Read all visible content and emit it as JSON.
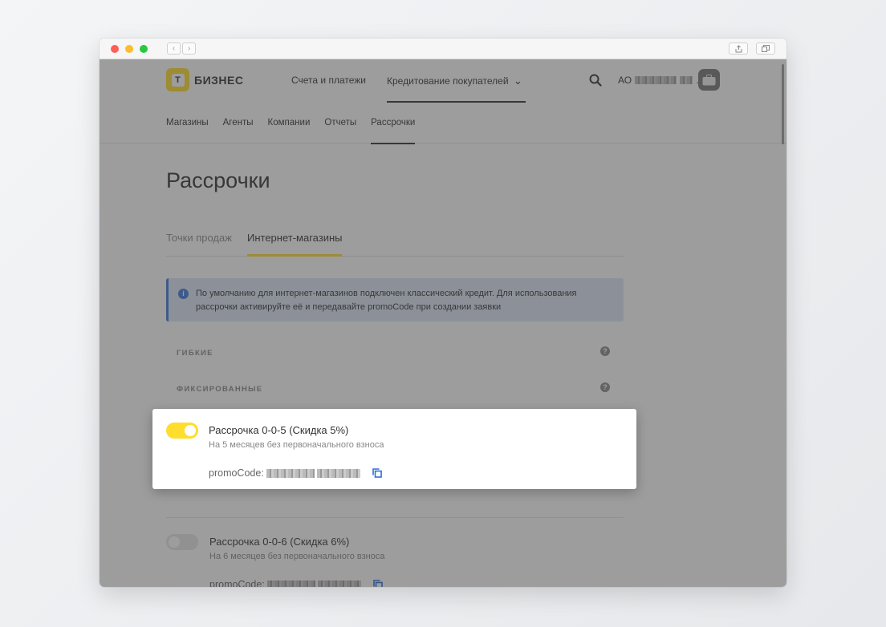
{
  "browser": {
    "back_glyph": "‹",
    "forward_glyph": "›",
    "share_icon": "share-icon",
    "tabs_icon": "tabs-icon"
  },
  "header": {
    "logo_letter": "Т",
    "logo_text": "БИЗНЕС",
    "nav": [
      "Счета и платежи",
      "Кредитование покупателей"
    ],
    "nav_dropdown_glyph": "⌄",
    "company_prefix": "АО",
    "company_suffix": "..."
  },
  "subnav": [
    "Магазины",
    "Агенты",
    "Компании",
    "Отчеты",
    "Рассрочки"
  ],
  "page": {
    "title": "Рассрочки",
    "tabs": [
      "Точки продаж",
      "Интернет-магазины"
    ],
    "info_icon": "i",
    "info_text": "По умолчанию для интернет-магазинов подключен классический кредит. Для использования рассрочки активируйте её и передавайте promoCode при создании заявки",
    "sections": [
      "ГИБКИЕ",
      "ФИКСИРОВАННЫЕ"
    ],
    "help_glyph": "?"
  },
  "items": [
    {
      "title": "Рассрочка 0-0-5 (Скидка 5%)",
      "subtitle": "На 5 месяцев без первоначального взноса",
      "promo_label": "promoCode:",
      "enabled": true
    },
    {
      "title": "Рассрочка 0-0-6 (Скидка 6%)",
      "subtitle": "На 6 месяцев без первоначального взноса",
      "promo_label": "promoCode:",
      "enabled": false
    }
  ],
  "colors": {
    "brand_yellow": "#ffdd2d",
    "info_blue": "#3e79d8",
    "copy_blue": "#2f6fd6"
  }
}
